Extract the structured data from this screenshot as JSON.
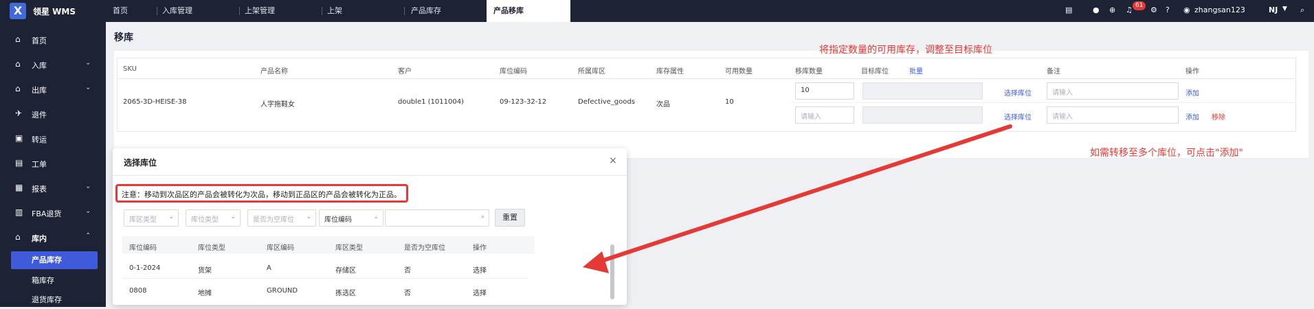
{
  "topbar": {
    "brand": "领星 WMS",
    "logo_letter": "X",
    "tabs": [
      {
        "label": "首页"
      },
      {
        "label": "入库管理"
      },
      {
        "label": "上架管理"
      },
      {
        "label": "上架"
      },
      {
        "label": "产品库存"
      },
      {
        "label": "产品移库"
      }
    ],
    "notification_count": "61",
    "username": "zhangsan123",
    "region": "NJ"
  },
  "sidebar": {
    "items": [
      {
        "label": "首页",
        "icon": "home-icon"
      },
      {
        "label": "入库",
        "icon": "inbound-icon"
      },
      {
        "label": "出库",
        "icon": "outbound-icon"
      },
      {
        "label": "退件",
        "icon": "return-icon"
      },
      {
        "label": "转运",
        "icon": "transfer-icon"
      },
      {
        "label": "工单",
        "icon": "workorder-icon"
      },
      {
        "label": "报表",
        "icon": "report-icon"
      },
      {
        "label": "FBA退货",
        "icon": "fba-return-icon"
      },
      {
        "label": "库内",
        "icon": "warehouse-icon"
      }
    ],
    "sub_items": [
      {
        "label": "产品库存"
      },
      {
        "label": "箱库存"
      },
      {
        "label": "退货库存"
      }
    ]
  },
  "page": {
    "title": "移库",
    "annotation_top": "将指定数量的可用库存，调整至目标库位",
    "annotation_right": "如需转移至多个库位，可点击\"添加\""
  },
  "grid": {
    "headers": [
      "SKU",
      "产品名称",
      "客户",
      "库位编码",
      "所属库区",
      "库存属性",
      "可用数量",
      "移库数量",
      "目标库位",
      "备注",
      "操作"
    ],
    "batch_label": "批量",
    "row": {
      "sku": "2065-3D-HEISE-38",
      "name": "人字拖鞋女",
      "customer": "double1 (1011004)",
      "location": "09-123-32-12",
      "zone": "Defective_goods",
      "attribute": "次品",
      "available": "10"
    },
    "lines": [
      {
        "qty": "10",
        "select_label": "选择库位",
        "remark_placeholder": "请输入",
        "add_label": "添加"
      },
      {
        "qty_placeholder": "请输入",
        "select_label": "选择库位",
        "remark_placeholder": "请输入",
        "add_label": "添加",
        "remove_label": "移除"
      }
    ]
  },
  "modal": {
    "title": "选择库位",
    "notice": "注意：移动到次品区的产品会被转化为次品，移动到正品区的产品会被转化为正品。",
    "filters": {
      "zone_type": "库区类型",
      "loc_type": "库位类型",
      "empty": "是否为空库位",
      "code_type": "库位编码",
      "reset": "重置"
    },
    "headers": [
      "库位编码",
      "库位类型",
      "库区编码",
      "库区类型",
      "是否为空库位",
      "操作"
    ],
    "rows": [
      {
        "code": "0-1-2024",
        "type": "货架",
        "zone_code": "A",
        "zone_type": "存储区",
        "empty": "否",
        "action": "选择"
      },
      {
        "code": "0808",
        "type": "地摊",
        "zone_code": "GROUND",
        "zone_type": "拣选区",
        "empty": "否",
        "action": "选择"
      }
    ]
  },
  "colors": {
    "topbar_bg": "#1e2235",
    "accent": "#3d5be0",
    "annotation": "#e53935"
  }
}
